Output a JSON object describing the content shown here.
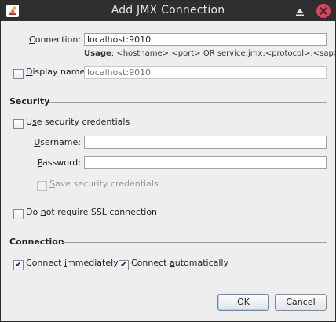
{
  "window": {
    "title": "Add JMX Connection"
  },
  "connection": {
    "label_pre": "",
    "label_mnemonic": "C",
    "label_post": "onnection:",
    "value": "localhost:9010",
    "usage_prefix": "Usage",
    "usage_text": ": <hostname>:<port> OR service:jmx:<protocol>:<sap>"
  },
  "display_name": {
    "label_mnemonic": "D",
    "label_post": "isplay name:",
    "checked": false,
    "placeholder": "localhost:9010"
  },
  "security": {
    "heading": "Security",
    "use_credentials_pre": "U",
    "use_credentials_mnemonic": "s",
    "use_credentials_post": "e security credentials",
    "username_mnemonic": "U",
    "username_post": "sername:",
    "username_value": "",
    "password_mnemonic": "P",
    "password_post": "assword:",
    "password_value": "",
    "save_credentials_mnemonic": "S",
    "save_credentials_post": "ave security credentials",
    "no_ssl_pre": "Do ",
    "no_ssl_mnemonic": "n",
    "no_ssl_post": "ot require SSL connection"
  },
  "connection_section": {
    "heading": "Connection",
    "immediately_pre": "Connect ",
    "immediately_mnemonic": "i",
    "immediately_post": "mmediately",
    "immediately_checked": true,
    "automatically_pre": "Connect ",
    "automatically_mnemonic": "a",
    "automatically_post": "utomatically",
    "automatically_checked": true
  },
  "buttons": {
    "ok": "OK",
    "cancel": "Cancel"
  },
  "colors": {
    "titlebar": "#2f2f2f",
    "close": "#e0425b",
    "separator": "#8fa0b8"
  },
  "icons": [
    "app-icon",
    "maximize-icon",
    "close-icon",
    "checkmark-icon"
  ]
}
